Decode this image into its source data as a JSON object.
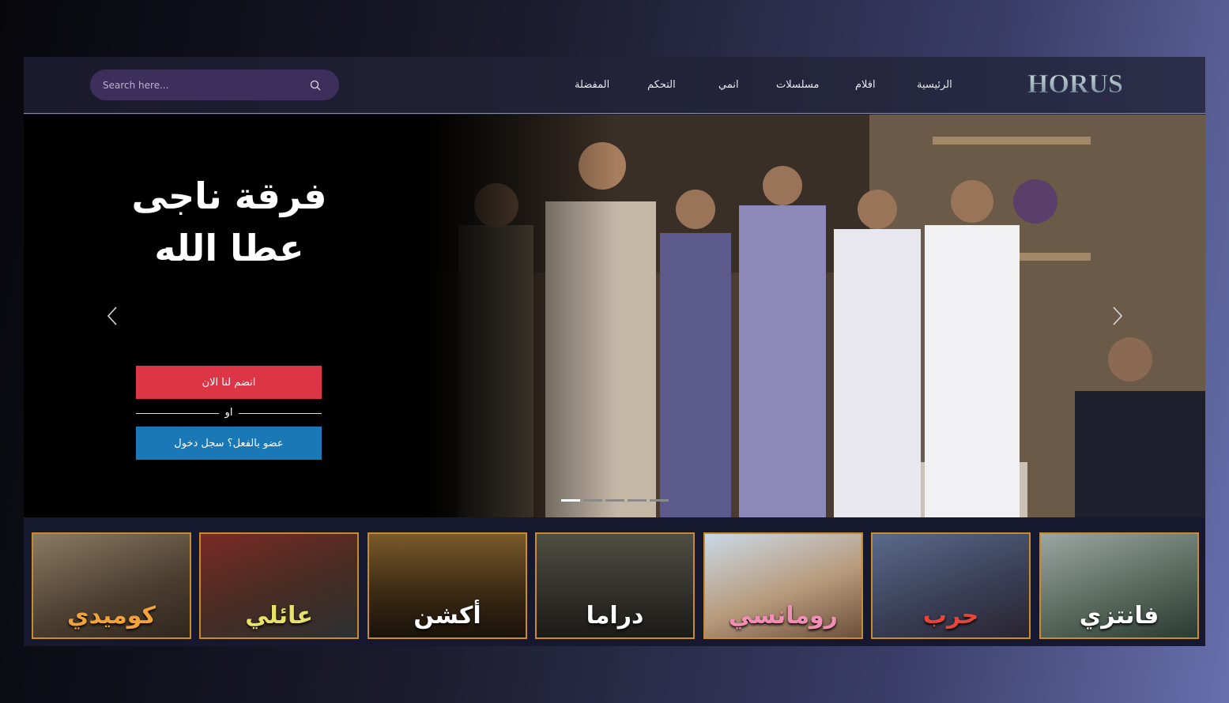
{
  "brand": {
    "logo_text": "HORUS"
  },
  "search": {
    "placeholder": "Search here..."
  },
  "nav": {
    "items": [
      "الرئيسية",
      "افلام",
      "مسلسلات",
      "انمي",
      "التحكم",
      "المفضلة"
    ]
  },
  "hero": {
    "title_line1": "فرقة ناجى",
    "title_line2": "عطا الله",
    "join_label": "انضم لنا الان",
    "or_label": "او",
    "login_label": "عضو بالفعل؟ سجل دخول",
    "slide_count": 5,
    "active_slide": 1
  },
  "categories": [
    {
      "label": "كوميدي",
      "color": "#f2a43a"
    },
    {
      "label": "عائلي",
      "color": "#e9e26a"
    },
    {
      "label": "أكشن",
      "color": "#ffffff"
    },
    {
      "label": "دراما",
      "color": "#ffffff"
    },
    {
      "label": "رومانسي",
      "color": "#f28db6"
    },
    {
      "label": "حرب",
      "color": "#e5463b"
    },
    {
      "label": "فانتزي",
      "color": "#ffffff"
    }
  ],
  "colors": {
    "join_button": "#dc3546",
    "login_button": "#1b78b6",
    "search_bg": "#3d2f5c",
    "card_border": "#c98c2c"
  }
}
